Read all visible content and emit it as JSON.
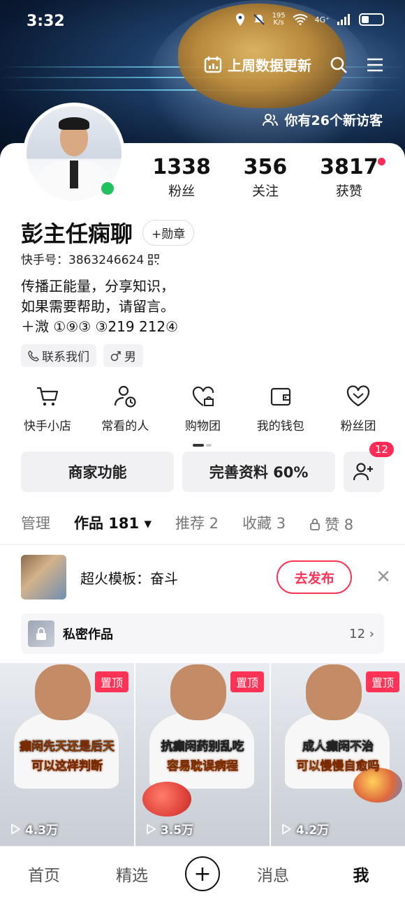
{
  "status_bar": {
    "time": "3:32",
    "net_speed": "195\nK/s",
    "signal": "4G⁺"
  },
  "header": {
    "weekly_update_label": "上周数据更新",
    "new_visitors_label": "你有26个新访客"
  },
  "profile": {
    "followers": {
      "count": "1338",
      "label": "粉丝"
    },
    "following": {
      "count": "356",
      "label": "关注"
    },
    "likes": {
      "count": "3817",
      "label": "获赞"
    },
    "name": "彭主任痫聊",
    "badge_button": "+勋章",
    "kuaishou_id": "快手号：3863246624 ",
    "bio": "传播正能量，分享知识，\n如果需要帮助，请留言。\n＋溦 ①⑨③ ③219 212④",
    "tags": {
      "contact": "联系我们",
      "gender": "男"
    }
  },
  "shortcuts": [
    {
      "label": "快手小店",
      "icon": "cart-icon"
    },
    {
      "label": "常看的人",
      "icon": "person-clock-icon"
    },
    {
      "label": "购物团",
      "icon": "heart-bag-icon"
    },
    {
      "label": "我的钱包",
      "icon": "wallet-icon"
    },
    {
      "label": "粉丝团",
      "icon": "heart-icon"
    }
  ],
  "actions": {
    "merchant": "商家功能",
    "complete_profile": "完善资料 60%",
    "friend_requests_count": "12"
  },
  "tabs": [
    {
      "label": "管理"
    },
    {
      "label": "作品 181 ▾",
      "active": true
    },
    {
      "label": "推荐 2"
    },
    {
      "label": "收藏 3"
    },
    {
      "label": "赞 8"
    }
  ],
  "template": {
    "text": "超火模板：奋斗",
    "publish": "去发布"
  },
  "private_works": {
    "label": "私密作品",
    "count": "12 ›"
  },
  "videos": [
    {
      "pin": "置顶",
      "caption1": "癫闲先天还是后天",
      "caption2": "可以这样判断",
      "views": "4.3万"
    },
    {
      "pin": "置顶",
      "caption1": "抗癫闲药别乱吃",
      "caption2": "容易耽误病程",
      "views": "3.5万"
    },
    {
      "pin": "置顶",
      "caption1": "成人癫闲不治",
      "caption2": "可以慢慢自愈吗",
      "views": "4.2万"
    }
  ],
  "bottom_nav": {
    "home": "首页",
    "featured": "精选",
    "messages": "消息",
    "me": "我"
  },
  "colors": {
    "accent": "#fe3355",
    "online": "#21c25e"
  }
}
